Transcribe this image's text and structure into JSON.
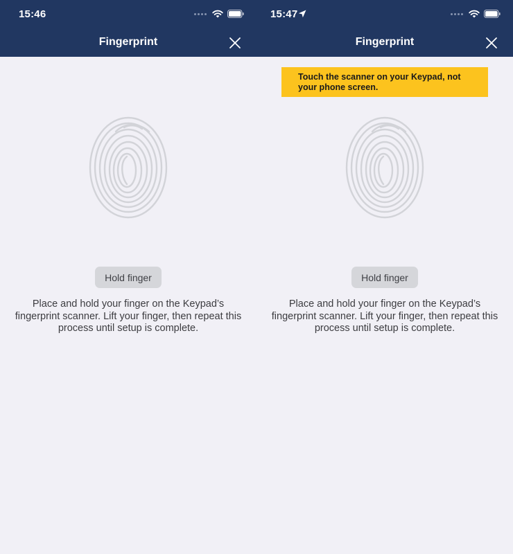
{
  "screens": [
    {
      "status": {
        "time": "15:46",
        "location_icon": ""
      },
      "nav": {
        "title": "Fingerprint",
        "close_icon": "close-icon"
      },
      "banner": null,
      "fingerprint_icon": "fingerprint-icon",
      "hold_button_label": "Hold finger",
      "instructions": "Place and hold your finger on the Keypad’s fingerprint scanner. Lift your finger, then repeat this process until setup is complete."
    },
    {
      "status": {
        "time": "15:47",
        "location_icon": "location-arrow-icon"
      },
      "nav": {
        "title": "Fingerprint",
        "close_icon": "close-icon"
      },
      "banner": {
        "text": "Touch the scanner on your Keypad, not your phone screen."
      },
      "fingerprint_icon": "fingerprint-icon",
      "hold_button_label": "Hold finger",
      "instructions": "Place and hold your finger on the Keypad’s fingerprint scanner. Lift your finger, then repeat this process until setup is complete."
    }
  ],
  "colors": {
    "nav_background": "#213761",
    "screen_background": "#f1f0f6",
    "banner_background": "#fcc31e",
    "button_background": "#d5d6da",
    "fingerprint_stroke": "#d2d3d8"
  }
}
